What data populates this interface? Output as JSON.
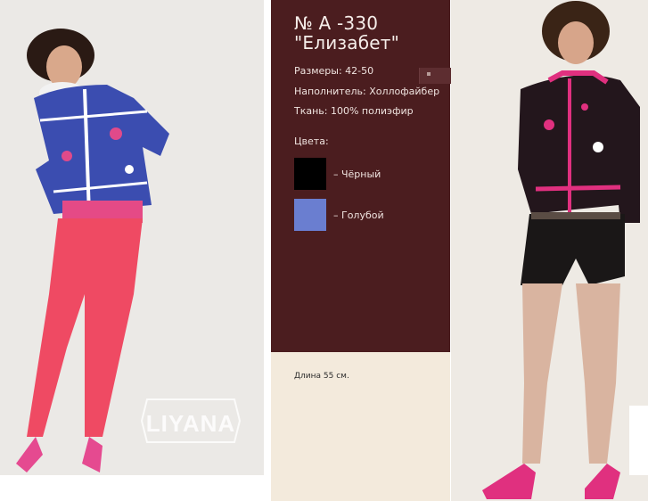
{
  "product": {
    "number": "№ А -330",
    "name": "\"Елизабет\"",
    "sizes": "Размеры: 42-50",
    "filler": "Наполнитель: Холлофайбер",
    "fabric": "Ткань:  100% полиэфир",
    "colors_label": "Цвета:",
    "colors": [
      {
        "label": "– Чёрный",
        "hex": "#000000"
      },
      {
        "label": "– Голубой",
        "hex": "#6a7ed0"
      }
    ],
    "length": "Длина 55 см."
  },
  "brand": {
    "logo_text": "LIYANA"
  },
  "theme": {
    "card_bg": "#4b1d1f",
    "lower_bg": "#f3eadc"
  }
}
